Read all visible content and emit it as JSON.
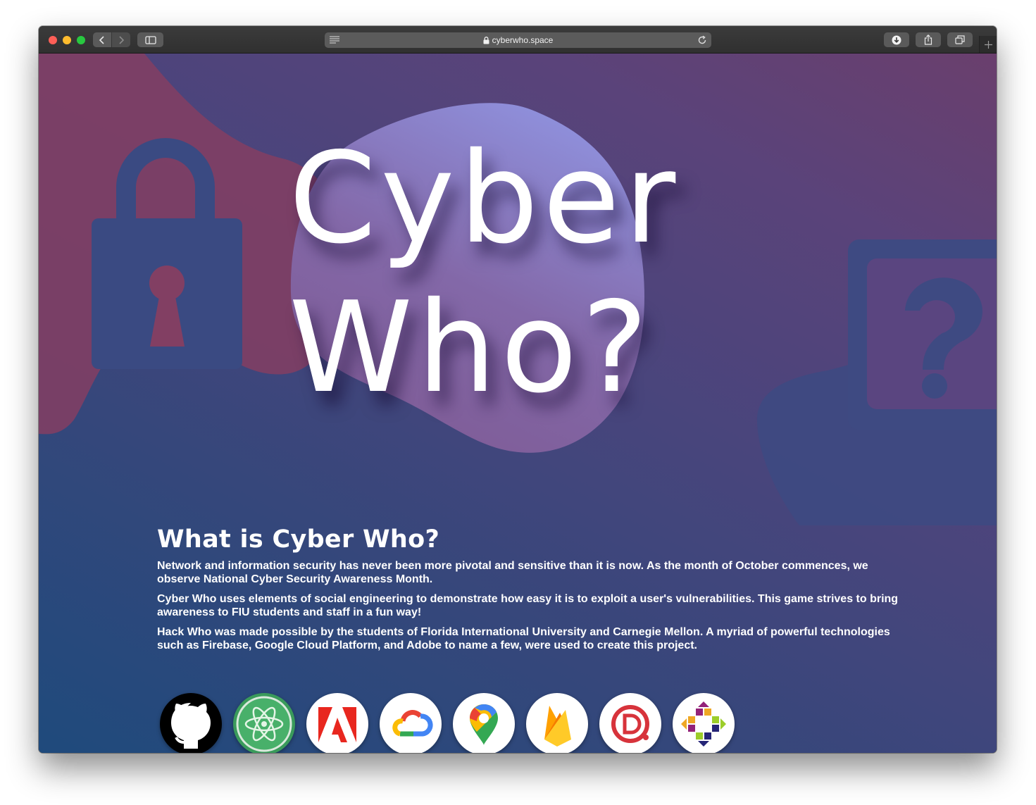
{
  "browser": {
    "url": "cyberwho.space"
  },
  "hero": {
    "title_line1": "Cyber",
    "title_line2": "Who?"
  },
  "about": {
    "heading": "What is Cyber Who?",
    "paragraphs": [
      "Network and information security has never been more pivotal and sensitive than it is now. As the month of October commences, we observe National Cyber Security Awareness Month.",
      "Cyber Who uses elements of social engineering to demonstrate how easy it is to exploit a user's vulnerabilities. This game strives to bring awareness to FIU students and staff in a fun way!",
      "Hack Who was made possible by the students of Florida International University and Carnegie Mellon. A myriad of powerful technologies such as Firebase, Google Cloud Platform, and Adobe to name a few, were used to create this project."
    ]
  },
  "technologies": [
    {
      "icon": "github-icon"
    },
    {
      "icon": "atom-icon"
    },
    {
      "icon": "adobe-icon"
    },
    {
      "icon": "google-cloud-icon"
    },
    {
      "icon": "google-maps-icon"
    },
    {
      "icon": "firebase-icon"
    },
    {
      "icon": "debian-icon"
    },
    {
      "icon": "centos-icon"
    }
  ],
  "colors": {
    "gradient_start": "#1f4a7c",
    "gradient_end": "#6a3f6d",
    "blob_pink": "#823f63",
    "blob_lavender": "#8f86d8",
    "text": "#ffffff"
  }
}
